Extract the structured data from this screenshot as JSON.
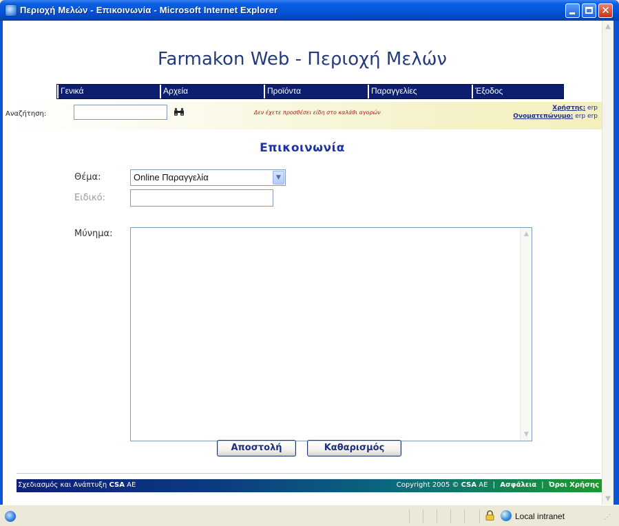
{
  "window": {
    "title": "Περιοχή Μελών - Επικοινωνία - Microsoft Internet Explorer",
    "close_glyph": "✕"
  },
  "site": {
    "title": "Farmakon Web - Περιοχή Μελών"
  },
  "nav": {
    "items": [
      {
        "label": "Γενικά"
      },
      {
        "label": "Αρχεία"
      },
      {
        "label": "Προϊόντα"
      },
      {
        "label": "Παραγγελίες"
      },
      {
        "label": "Έξοδος"
      }
    ]
  },
  "search": {
    "label": "Αναζήτηση:",
    "value": "",
    "cart_message": "Δεν έχετε προσθέσει είδη στο καλάθι αγορών"
  },
  "user": {
    "user_label": "Χρήστης:",
    "user_value": "erp",
    "name_label": "Ονοματεπώνυμο:",
    "name_value": "erp erp"
  },
  "form": {
    "heading": "Επικοινωνία",
    "subject_label": "Θέμα:",
    "subject_value": "Online Παραγγελία",
    "specific_label": "Ειδικό:",
    "specific_value": "",
    "message_label": "Μύνημα:",
    "message_value": "",
    "send_label": "Αποστολή",
    "clear_label": "Καθαρισμός"
  },
  "footer": {
    "design_text": "Σχεδιασμός και Ανάπτυξη",
    "design_company": "CSA",
    "design_suffix": "AE",
    "copyright_text": "Copyright 2005 ©",
    "copyright_company": "CSA",
    "copyright_suffix": "AE",
    "security_link": "Ασφάλεια",
    "terms_link": "Όροι Χρήσης",
    "separator": "|"
  },
  "statusbar": {
    "zone": "Local intranet"
  },
  "colors": {
    "nav_bg": "#0E1E6E",
    "heading": "#1E33A8",
    "cart_message": "#B0201A",
    "footer_start": "#0D1F7A",
    "footer_end": "#1A9A2E"
  }
}
